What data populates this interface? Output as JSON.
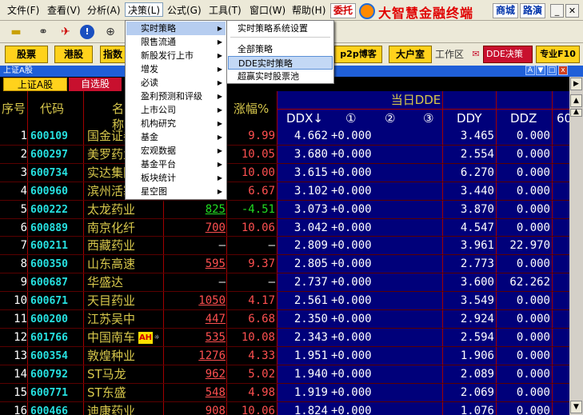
{
  "menubar": {
    "items": [
      "文件(F)",
      "查看(V)",
      "分析(A)",
      "决策(L)",
      "公式(G)",
      "工具(T)",
      "窗口(W)",
      "帮助(H)"
    ],
    "entrust": "委托",
    "brand": "大智慧金融终端",
    "store": "商城",
    "roadshow": "路演"
  },
  "buttonbar": {
    "stocks": "股票",
    "hk": "港股",
    "index": "指数",
    "p2p": "p2p博客",
    "dahushi": "大户室",
    "workspace": "工作区",
    "dde": "DDE决策",
    "pro": "专业F10"
  },
  "window_title": "上证A股",
  "tabs": {
    "a_share": "上证A股",
    "watchlist": "自选股"
  },
  "table": {
    "group_header": "当日DDE",
    "headers": {
      "seq": "序号",
      "code": "代码",
      "name": "名称",
      "chg": "涨幅%",
      "ddx": "DDX↓",
      "q1": "①",
      "q2": "②",
      "q3": "③",
      "ddy": "DDY",
      "ddz": "DDZ",
      "col60": "60"
    },
    "rows": [
      {
        "seq": "1",
        "code": "600109",
        "name": "国金证券",
        "price": "",
        "chg": "9.99",
        "ddx": "4.662",
        "q1": "+0.000",
        "ddy": "3.465",
        "ddz": "0.000",
        "dir": "up"
      },
      {
        "seq": "2",
        "code": "600297",
        "name": "美罗药业",
        "price": "",
        "chg": "10.05",
        "ddx": "3.680",
        "q1": "+0.000",
        "ddy": "2.554",
        "ddz": "0.000",
        "dir": "up"
      },
      {
        "seq": "3",
        "code": "600734",
        "name": "实达集团",
        "price": "",
        "chg": "10.00",
        "ddx": "3.615",
        "q1": "+0.000",
        "ddy": "6.270",
        "ddz": "0.000",
        "dir": "up"
      },
      {
        "seq": "4",
        "code": "600960",
        "name": "滨州活塞",
        "price": "",
        "chg": "6.67",
        "ddx": "3.102",
        "q1": "+0.000",
        "ddy": "3.440",
        "ddz": "0.000",
        "dir": "up"
      },
      {
        "seq": "5",
        "code": "600222",
        "name": "太龙药业",
        "price": "825",
        "chg": "-4.51",
        "ddx": "3.073",
        "q1": "+0.000",
        "ddy": "3.870",
        "ddz": "0.000",
        "dir": "down"
      },
      {
        "seq": "6",
        "code": "600889",
        "name": "南京化纤",
        "price": "700",
        "chg": "10.06",
        "ddx": "3.042",
        "q1": "+0.000",
        "ddy": "4.547",
        "ddz": "0.000",
        "dir": "up"
      },
      {
        "seq": "7",
        "code": "600211",
        "name": "西藏药业",
        "price": "—",
        "chg": "—",
        "ddx": "2.809",
        "q1": "+0.000",
        "ddy": "3.961",
        "ddz": "22.970",
        "dir": "flat"
      },
      {
        "seq": "8",
        "code": "600350",
        "name": "山东高速",
        "price": "595",
        "chg": "9.37",
        "ddx": "2.805",
        "q1": "+0.000",
        "ddy": "2.773",
        "ddz": "0.000",
        "dir": "up"
      },
      {
        "seq": "9",
        "code": "600687",
        "name": "华盛达",
        "price": "—",
        "chg": "—",
        "ddx": "2.737",
        "q1": "+0.000",
        "ddy": "3.600",
        "ddz": "62.262",
        "dir": "flat"
      },
      {
        "seq": "10",
        "code": "600671",
        "name": "天目药业",
        "price": "1050",
        "chg": "4.17",
        "ddx": "2.561",
        "q1": "+0.000",
        "ddy": "3.549",
        "ddz": "0.000",
        "dir": "up"
      },
      {
        "seq": "11",
        "code": "600200",
        "name": "江苏吴中",
        "price": "447",
        "chg": "6.68",
        "ddx": "2.350",
        "q1": "+0.000",
        "ddy": "2.924",
        "ddz": "0.000",
        "dir": "up"
      },
      {
        "seq": "12",
        "code": "601766",
        "name": "中国南车",
        "price": "535",
        "chg": "10.08",
        "ddx": "2.343",
        "q1": "+0.000",
        "ddy": "2.594",
        "ddz": "0.000",
        "dir": "up",
        "badge": "AH"
      },
      {
        "seq": "13",
        "code": "600354",
        "name": "敦煌种业",
        "price": "1276",
        "chg": "4.33",
        "ddx": "1.951",
        "q1": "+0.000",
        "ddy": "1.906",
        "ddz": "0.000",
        "dir": "up"
      },
      {
        "seq": "14",
        "code": "600792",
        "name": "ST马龙",
        "price": "962",
        "chg": "5.02",
        "ddx": "1.940",
        "q1": "+0.000",
        "ddy": "2.089",
        "ddz": "0.000",
        "dir": "up"
      },
      {
        "seq": "15",
        "code": "600771",
        "name": "ST东盛",
        "price": "548",
        "chg": "4.98",
        "ddx": "1.919",
        "q1": "+0.000",
        "ddy": "2.069",
        "ddz": "0.000",
        "dir": "up"
      },
      {
        "seq": "16",
        "code": "600466",
        "name": "迪康药业",
        "price": "908",
        "chg": "10.06",
        "ddx": "1.824",
        "q1": "+0.000",
        "ddy": "1.076",
        "ddz": "0.000",
        "dir": "up"
      }
    ]
  },
  "menu_decision": {
    "items": [
      "实时策略",
      "限售流通",
      "新股发行上市",
      "增发",
      "必读",
      "盈利预测和评级",
      "上市公司",
      "机构研究",
      "基金",
      "宏观数据",
      "基金平台",
      "板块统计",
      "星空图"
    ]
  },
  "menu_realtime": {
    "settings": "实时策略系统设置",
    "all": "全部策略",
    "dde": "DDE实时策略",
    "super": "超赢实时股票池"
  },
  "colors": {
    "accent_red": "#c8102e",
    "up": "#ff5050",
    "down": "#22dd22",
    "code": "#26e0e0",
    "name": "#d8c84c",
    "dde_bg": "#00007a"
  }
}
